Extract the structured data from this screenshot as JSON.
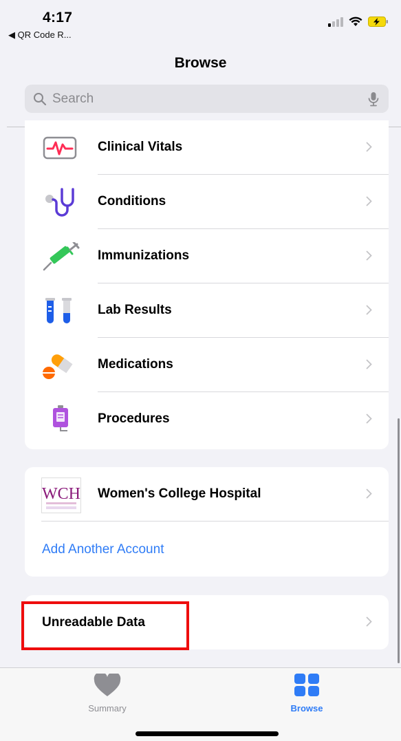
{
  "status_bar": {
    "time": "4:17",
    "back_app": "◀ QR Code R..."
  },
  "nav": {
    "title": "Browse"
  },
  "search": {
    "placeholder": "Search"
  },
  "categories": [
    {
      "label": "Clinical Vitals",
      "icon": "heart-monitor-icon"
    },
    {
      "label": "Conditions",
      "icon": "stethoscope-icon"
    },
    {
      "label": "Immunizations",
      "icon": "syringe-icon"
    },
    {
      "label": "Lab Results",
      "icon": "test-tubes-icon"
    },
    {
      "label": "Medications",
      "icon": "pills-icon"
    },
    {
      "label": "Procedures",
      "icon": "iv-bag-icon"
    }
  ],
  "accounts": {
    "hospital": {
      "name": "Women's College Hospital",
      "logo_text": "WCH",
      "icon": "hospital-logo"
    },
    "add_label": "Add Another Account"
  },
  "unreadable": {
    "label": "Unreadable Data"
  },
  "tabs": {
    "summary": {
      "label": "Summary",
      "icon": "heart-icon"
    },
    "browse": {
      "label": "Browse",
      "icon": "grid-icon",
      "active": true
    }
  },
  "colors": {
    "accent": "#2f7cf6",
    "highlight": "#ee0d0d",
    "background": "#f2f2f7"
  }
}
